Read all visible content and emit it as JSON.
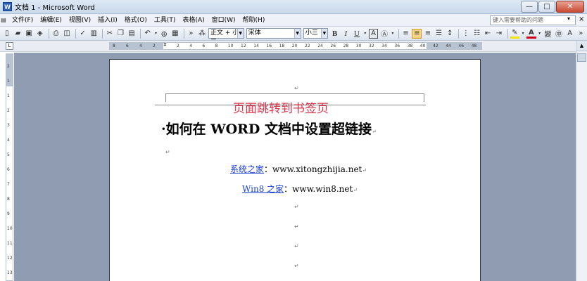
{
  "window": {
    "title": "文档 1 - Microsoft Word",
    "app_icon": "W",
    "minimize": "—",
    "maximize": "□",
    "close": "✕"
  },
  "menu": {
    "items": [
      "文件(F)",
      "编辑(E)",
      "视图(V)",
      "插入(I)",
      "格式(O)",
      "工具(T)",
      "表格(A)",
      "窗口(W)",
      "帮助(H)"
    ],
    "help_placeholder": "键入需要帮助的问题",
    "help_dropdown": "▾",
    "close_doc": "×"
  },
  "toolbar": {
    "style_value": "正文 + 小三",
    "font_value": "宋体",
    "size_value": "小三",
    "bold": "B",
    "italic": "I",
    "underline": "U",
    "font_color_letter": "A",
    "char_scale_letter": "A",
    "highlight_letter": "A",
    "font_color_hex": "#d0021b",
    "highlight_hex": "#f5e300"
  },
  "ruler": {
    "corner": "L",
    "h_numbers": [
      "8",
      "6",
      "4",
      "2",
      "2",
      "4",
      "6",
      "8",
      "10",
      "12",
      "14",
      "16",
      "18",
      "20",
      "22",
      "24",
      "26",
      "28",
      "30",
      "32",
      "34",
      "36",
      "38",
      "40",
      "42",
      "44",
      "46",
      "48"
    ],
    "v_numbers": [
      "2",
      "1",
      "1",
      "2",
      "3",
      "4",
      "5",
      "6",
      "7",
      "8",
      "9",
      "10",
      "11",
      "12",
      "13"
    ]
  },
  "document": {
    "header_text": "页面跳转到书签页",
    "title_bullet": "·",
    "title": "如何在 WORD 文档中设置超链接",
    "link1_text": "系统之家",
    "link1_sep": "：",
    "link1_url": "www.xitongzhijia.net",
    "link2_text": "Win8 之家",
    "link2_sep": "：",
    "link2_url": "www.win8.net",
    "paragraph_mark": "↵"
  },
  "colors": {
    "header_red": "#d9364b",
    "link_blue": "#1b3fd1",
    "workspace_bg": "#8f9cb2"
  }
}
